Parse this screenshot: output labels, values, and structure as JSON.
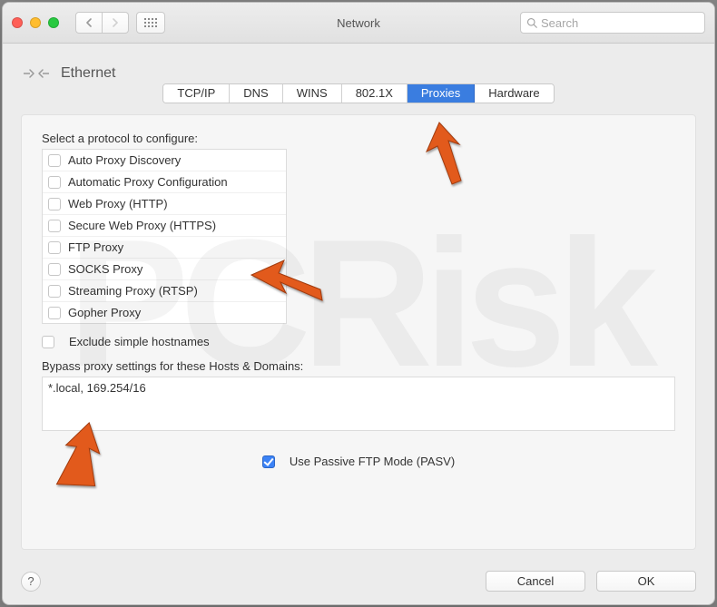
{
  "window": {
    "title": "Network"
  },
  "search": {
    "placeholder": "Search"
  },
  "header": {
    "interface": "Ethernet"
  },
  "tabs": [
    {
      "label": "TCP/IP",
      "active": false
    },
    {
      "label": "DNS",
      "active": false
    },
    {
      "label": "WINS",
      "active": false
    },
    {
      "label": "802.1X",
      "active": false
    },
    {
      "label": "Proxies",
      "active": true
    },
    {
      "label": "Hardware",
      "active": false
    }
  ],
  "labels": {
    "select_protocol": "Select a protocol to configure:",
    "exclude_simple": "Exclude simple hostnames",
    "bypass_label": "Bypass proxy settings for these Hosts & Domains:",
    "pasv": "Use Passive FTP Mode (PASV)"
  },
  "protocols": [
    {
      "name": "Auto Proxy Discovery",
      "checked": false
    },
    {
      "name": "Automatic Proxy Configuration",
      "checked": false
    },
    {
      "name": "Web Proxy (HTTP)",
      "checked": false
    },
    {
      "name": "Secure Web Proxy (HTTPS)",
      "checked": false
    },
    {
      "name": "FTP Proxy",
      "checked": false
    },
    {
      "name": "SOCKS Proxy",
      "checked": false
    },
    {
      "name": "Streaming Proxy (RTSP)",
      "checked": false
    },
    {
      "name": "Gopher Proxy",
      "checked": false
    }
  ],
  "exclude_simple_checked": false,
  "bypass_value": "*.local, 169.254/16",
  "pasv_checked": true,
  "buttons": {
    "cancel": "Cancel",
    "ok": "OK",
    "help": "?"
  },
  "annotation_color": "#e25a1d"
}
